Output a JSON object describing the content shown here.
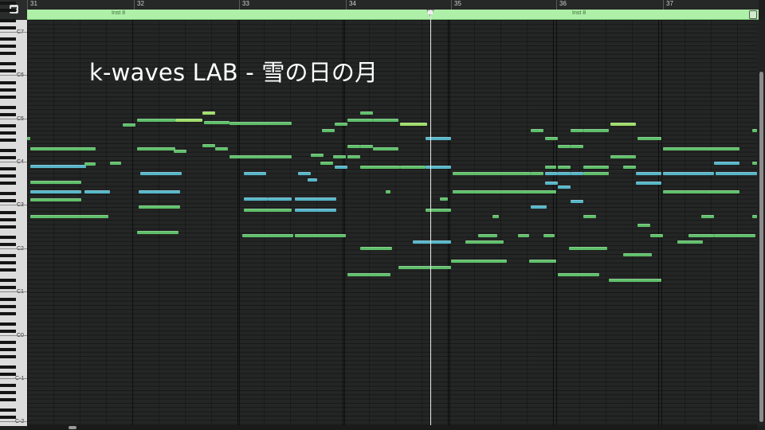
{
  "ruler": {
    "bars": [
      "31",
      "32",
      "33",
      "34",
      "35",
      "36",
      "37"
    ]
  },
  "region": {
    "labels": [
      "Inst 8",
      "Inst 8"
    ]
  },
  "keyboard": {
    "octave_labels": [
      "C7",
      "C6",
      "C5",
      "C4",
      "C3",
      "C2",
      "C1",
      "C0",
      "C-1",
      "C-2"
    ]
  },
  "overlay": {
    "title": "k-waves LAB - 雪の日の月"
  },
  "colors": {
    "note_green": "#5fbf6a",
    "note_light_green": "#9fdc6a",
    "note_teal": "#4fb3a0",
    "note_cyan": "#56b6c8",
    "region": "#aef0a8",
    "playhead": "#e8e8e8"
  },
  "icons": {
    "corner": "piano-roll-menu-icon",
    "playhead": "playhead-marker-icon"
  }
}
